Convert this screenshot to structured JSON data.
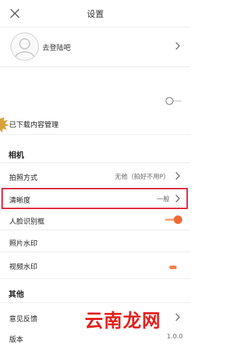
{
  "header": {
    "title": "设置",
    "close_icon": "close-icon"
  },
  "account": {
    "avatar_icon": "avatar-icon",
    "login_label": "去登陆吧"
  },
  "downloads": {
    "label": "已下载内容管理",
    "toggle_on": false
  },
  "camera": {
    "heading": "相机",
    "shooting_mode": {
      "label": "拍照方式",
      "value": "无他（拍好不用P）"
    },
    "clarity": {
      "label": "清晰度",
      "value": "一般"
    },
    "face_detect": {
      "label": "人脸识别框",
      "toggle_on": true
    },
    "photo_watermark": {
      "label": "照片水印"
    },
    "video_watermark": {
      "label": "视频水印"
    }
  },
  "other": {
    "heading": "其他",
    "feedback": {
      "label": "意见反馈"
    },
    "version": {
      "label": "版本",
      "value": "1.0.0"
    }
  },
  "overlay": {
    "watermark_text": "云南龙网"
  },
  "colors": {
    "accent": "#f06a33",
    "highlight_border": "#e0243a",
    "watermark": "#e3201b"
  }
}
